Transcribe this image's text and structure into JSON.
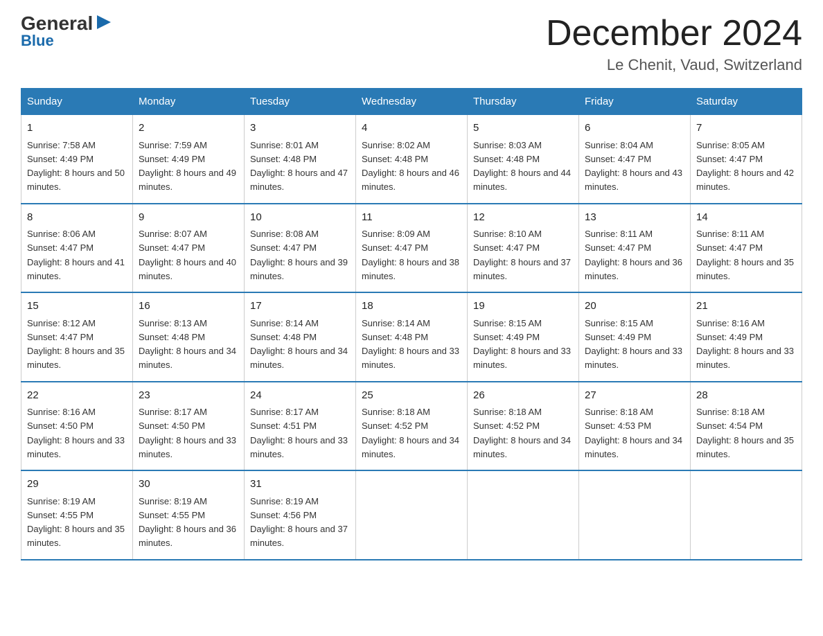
{
  "logo": {
    "general": "General",
    "arrow": "▶",
    "blue": "Blue"
  },
  "title": "December 2024",
  "location": "Le Chenit, Vaud, Switzerland",
  "weekdays": [
    "Sunday",
    "Monday",
    "Tuesday",
    "Wednesday",
    "Thursday",
    "Friday",
    "Saturday"
  ],
  "weeks": [
    [
      {
        "day": "1",
        "sunrise": "7:58 AM",
        "sunset": "4:49 PM",
        "daylight": "8 hours and 50 minutes."
      },
      {
        "day": "2",
        "sunrise": "7:59 AM",
        "sunset": "4:49 PM",
        "daylight": "8 hours and 49 minutes."
      },
      {
        "day": "3",
        "sunrise": "8:01 AM",
        "sunset": "4:48 PM",
        "daylight": "8 hours and 47 minutes."
      },
      {
        "day": "4",
        "sunrise": "8:02 AM",
        "sunset": "4:48 PM",
        "daylight": "8 hours and 46 minutes."
      },
      {
        "day": "5",
        "sunrise": "8:03 AM",
        "sunset": "4:48 PM",
        "daylight": "8 hours and 44 minutes."
      },
      {
        "day": "6",
        "sunrise": "8:04 AM",
        "sunset": "4:47 PM",
        "daylight": "8 hours and 43 minutes."
      },
      {
        "day": "7",
        "sunrise": "8:05 AM",
        "sunset": "4:47 PM",
        "daylight": "8 hours and 42 minutes."
      }
    ],
    [
      {
        "day": "8",
        "sunrise": "8:06 AM",
        "sunset": "4:47 PM",
        "daylight": "8 hours and 41 minutes."
      },
      {
        "day": "9",
        "sunrise": "8:07 AM",
        "sunset": "4:47 PM",
        "daylight": "8 hours and 40 minutes."
      },
      {
        "day": "10",
        "sunrise": "8:08 AM",
        "sunset": "4:47 PM",
        "daylight": "8 hours and 39 minutes."
      },
      {
        "day": "11",
        "sunrise": "8:09 AM",
        "sunset": "4:47 PM",
        "daylight": "8 hours and 38 minutes."
      },
      {
        "day": "12",
        "sunrise": "8:10 AM",
        "sunset": "4:47 PM",
        "daylight": "8 hours and 37 minutes."
      },
      {
        "day": "13",
        "sunrise": "8:11 AM",
        "sunset": "4:47 PM",
        "daylight": "8 hours and 36 minutes."
      },
      {
        "day": "14",
        "sunrise": "8:11 AM",
        "sunset": "4:47 PM",
        "daylight": "8 hours and 35 minutes."
      }
    ],
    [
      {
        "day": "15",
        "sunrise": "8:12 AM",
        "sunset": "4:47 PM",
        "daylight": "8 hours and 35 minutes."
      },
      {
        "day": "16",
        "sunrise": "8:13 AM",
        "sunset": "4:48 PM",
        "daylight": "8 hours and 34 minutes."
      },
      {
        "day": "17",
        "sunrise": "8:14 AM",
        "sunset": "4:48 PM",
        "daylight": "8 hours and 34 minutes."
      },
      {
        "day": "18",
        "sunrise": "8:14 AM",
        "sunset": "4:48 PM",
        "daylight": "8 hours and 33 minutes."
      },
      {
        "day": "19",
        "sunrise": "8:15 AM",
        "sunset": "4:49 PM",
        "daylight": "8 hours and 33 minutes."
      },
      {
        "day": "20",
        "sunrise": "8:15 AM",
        "sunset": "4:49 PM",
        "daylight": "8 hours and 33 minutes."
      },
      {
        "day": "21",
        "sunrise": "8:16 AM",
        "sunset": "4:49 PM",
        "daylight": "8 hours and 33 minutes."
      }
    ],
    [
      {
        "day": "22",
        "sunrise": "8:16 AM",
        "sunset": "4:50 PM",
        "daylight": "8 hours and 33 minutes."
      },
      {
        "day": "23",
        "sunrise": "8:17 AM",
        "sunset": "4:50 PM",
        "daylight": "8 hours and 33 minutes."
      },
      {
        "day": "24",
        "sunrise": "8:17 AM",
        "sunset": "4:51 PM",
        "daylight": "8 hours and 33 minutes."
      },
      {
        "day": "25",
        "sunrise": "8:18 AM",
        "sunset": "4:52 PM",
        "daylight": "8 hours and 34 minutes."
      },
      {
        "day": "26",
        "sunrise": "8:18 AM",
        "sunset": "4:52 PM",
        "daylight": "8 hours and 34 minutes."
      },
      {
        "day": "27",
        "sunrise": "8:18 AM",
        "sunset": "4:53 PM",
        "daylight": "8 hours and 34 minutes."
      },
      {
        "day": "28",
        "sunrise": "8:18 AM",
        "sunset": "4:54 PM",
        "daylight": "8 hours and 35 minutes."
      }
    ],
    [
      {
        "day": "29",
        "sunrise": "8:19 AM",
        "sunset": "4:55 PM",
        "daylight": "8 hours and 35 minutes."
      },
      {
        "day": "30",
        "sunrise": "8:19 AM",
        "sunset": "4:55 PM",
        "daylight": "8 hours and 36 minutes."
      },
      {
        "day": "31",
        "sunrise": "8:19 AM",
        "sunset": "4:56 PM",
        "daylight": "8 hours and 37 minutes."
      },
      null,
      null,
      null,
      null
    ]
  ]
}
